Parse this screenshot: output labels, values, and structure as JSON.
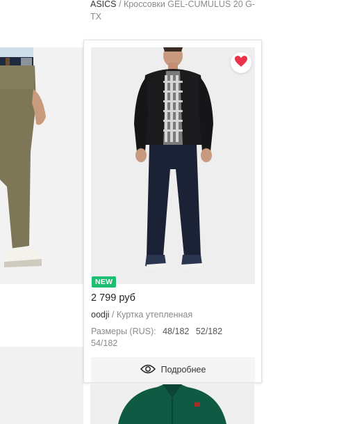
{
  "top_product": {
    "brand": "ASICS",
    "separator": " / ",
    "name": "Кроссовки GEL-CUMULUS 20 G-TX"
  },
  "card": {
    "badge": "NEW",
    "price": "2 799 руб",
    "brand": "oodji",
    "separator": " / ",
    "name": "Куртка утепленная",
    "sizes_label": "Размеры (RUS):",
    "sizes": [
      "48/182",
      "52/182",
      "54/182"
    ],
    "details_label": "Подробнее",
    "favorite_icon": "heart-icon",
    "favorite_color": "#e8334a",
    "details_icon": "eye-icon"
  },
  "colors": {
    "badge_green": "#1fbf73",
    "heart_red": "#e8334a"
  }
}
